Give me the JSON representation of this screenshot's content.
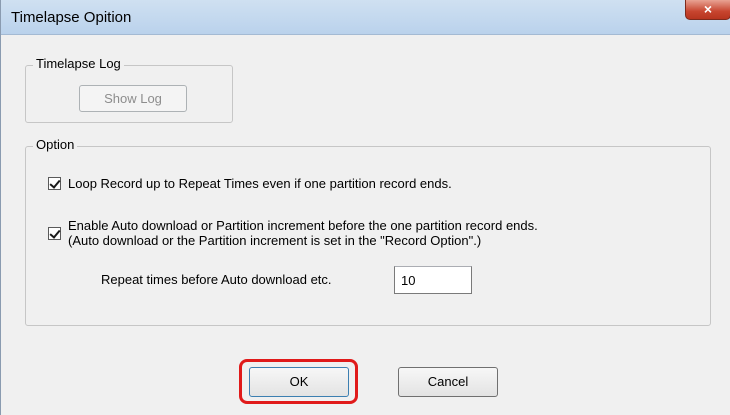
{
  "window": {
    "title": "Timelapse Opition",
    "close_glyph": "×"
  },
  "timelapse_log": {
    "legend": "Timelapse Log",
    "show_log_label": "Show Log"
  },
  "option": {
    "legend": "Option",
    "loop_record": {
      "checked": true,
      "label": "Loop Record up to Repeat Times even if one partition record ends."
    },
    "enable_auto": {
      "checked": true,
      "label_line1": "Enable Auto download or Partition increment before the one partition record ends.",
      "label_line2": "(Auto download or the Partition increment is set in the \"Record Option\".)"
    },
    "repeat_times": {
      "label": "Repeat times before Auto download etc.",
      "value": "10"
    }
  },
  "footer": {
    "ok_label": "OK",
    "cancel_label": "Cancel"
  },
  "colors": {
    "highlight": "#e01a1a",
    "titlebar": "#bad2ec",
    "dialog_bg": "#f0f0f0"
  }
}
